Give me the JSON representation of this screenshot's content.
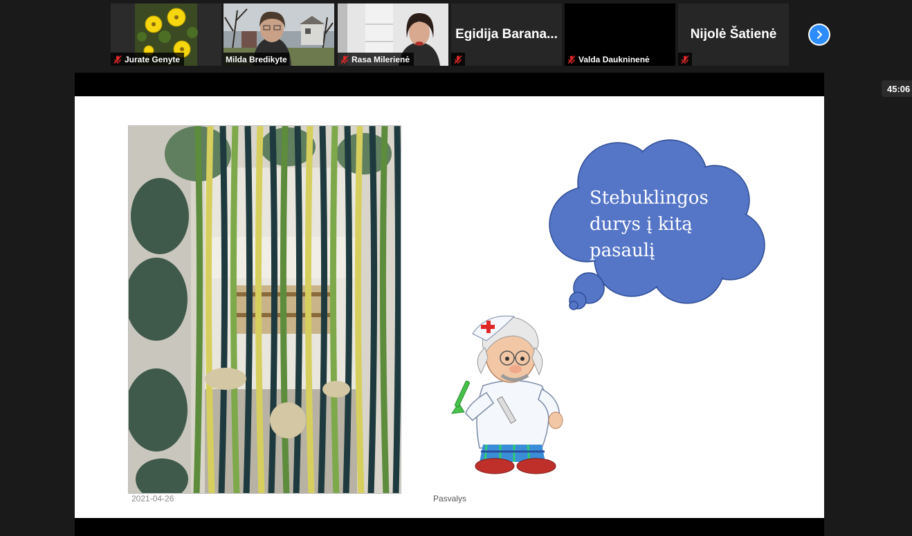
{
  "participants": [
    {
      "name": "Jurate Genyte",
      "muted": true,
      "video": "flowers"
    },
    {
      "name": "Milda Bredikyte",
      "muted": false,
      "video": "person-outdoor",
      "active": true
    },
    {
      "name": "Rasa Milerienė",
      "muted": true,
      "video": "person-indoor"
    },
    {
      "name": "Egidija Barana...",
      "muted": true,
      "video": "none",
      "name_center": true
    },
    {
      "name": "Valda Daukninenė",
      "muted": true,
      "video": "black"
    },
    {
      "name": "Nijolė Šatienė",
      "muted": true,
      "video": "none",
      "name_center": true
    }
  ],
  "meeting": {
    "elapsed_time": "45:06",
    "next_page_icon": "chevron-right-icon"
  },
  "slide": {
    "cloud_text": [
      "Stebuklingos",
      "durys į kitą",
      "pasaulį"
    ],
    "date": "2021-04-26",
    "place": "Pasvalys",
    "cloud_color": "#5575c7"
  },
  "colors": {
    "accent_blue": "#2d8cff",
    "active_border": "#c9d84a",
    "mute_red": "#e02828"
  }
}
